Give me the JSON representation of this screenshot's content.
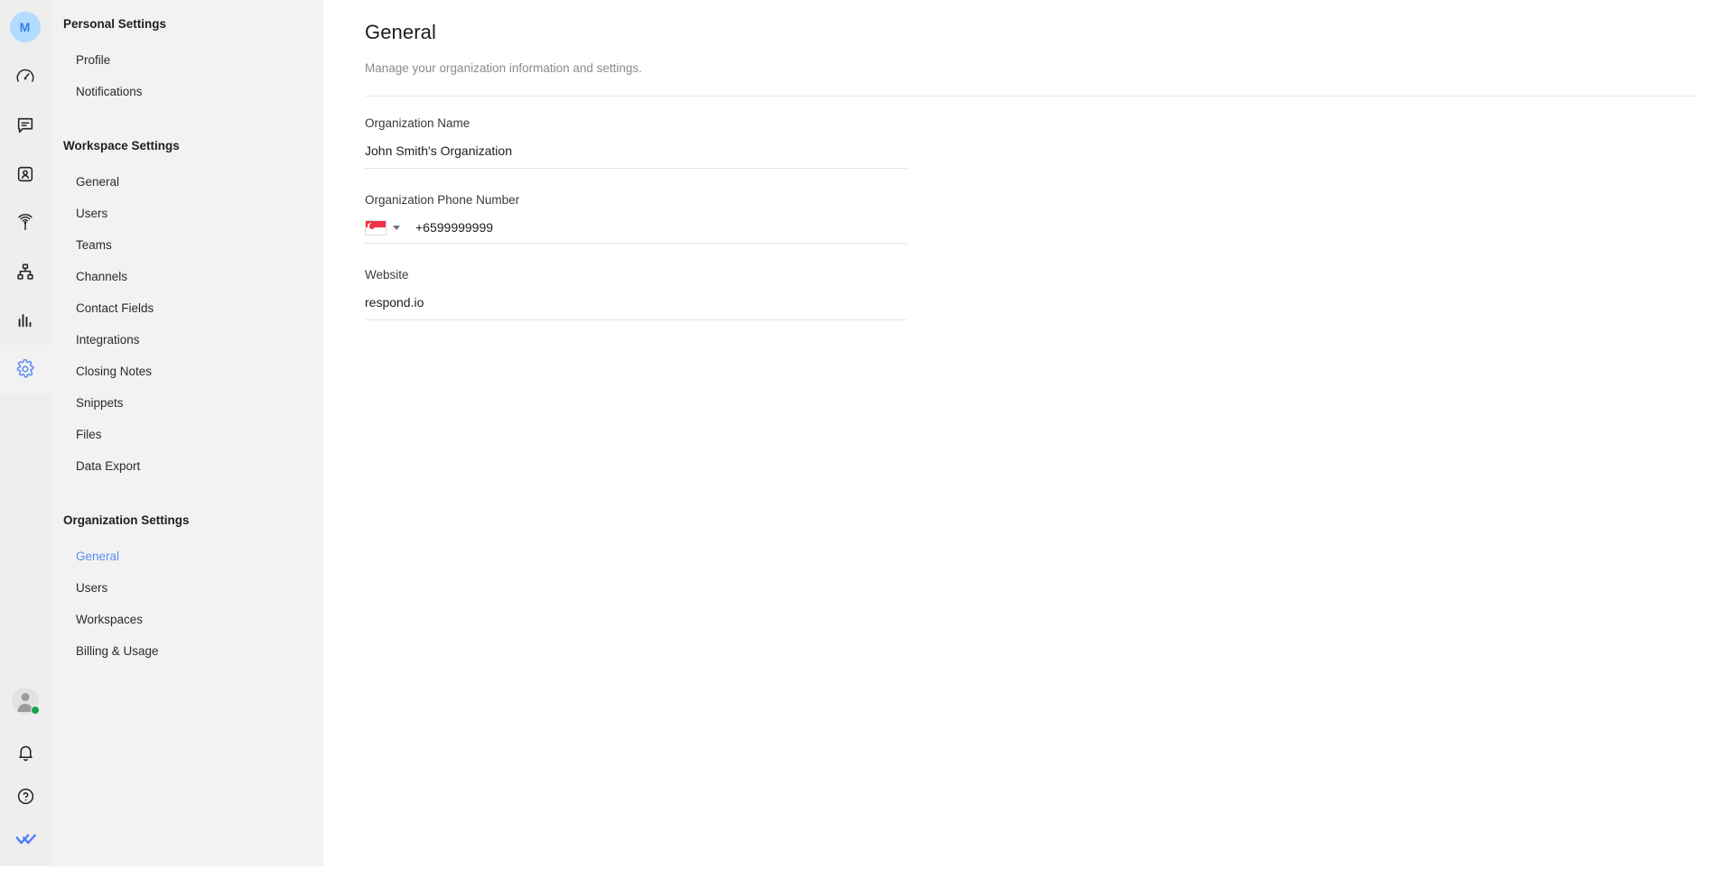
{
  "rail": {
    "org_avatar_initial": "M",
    "icons": [
      {
        "name": "dashboard-icon",
        "label": "Dashboard",
        "active": false
      },
      {
        "name": "messages-icon",
        "label": "Messages",
        "active": false
      },
      {
        "name": "contacts-icon",
        "label": "Contacts",
        "active": false
      },
      {
        "name": "broadcasts-icon",
        "label": "Broadcasts",
        "active": false
      },
      {
        "name": "workflows-icon",
        "label": "Workflows",
        "active": false
      },
      {
        "name": "reports-icon",
        "label": "Reports",
        "active": false
      },
      {
        "name": "settings-gear-icon",
        "label": "Settings",
        "active": true
      }
    ],
    "bottom_icons": [
      {
        "name": "user-avatar",
        "label": "User profile",
        "status": "online"
      },
      {
        "name": "bell-icon",
        "label": "Notifications"
      },
      {
        "name": "help-circle-icon",
        "label": "Help"
      },
      {
        "name": "respond-io-logo-icon",
        "label": "respond.io"
      }
    ],
    "active_color": "#5b8def",
    "status_color": "#16a34a"
  },
  "sidebar": {
    "groups": [
      {
        "title": "Personal Settings",
        "items": [
          {
            "label": "Profile",
            "active": false
          },
          {
            "label": "Notifications",
            "active": false
          }
        ]
      },
      {
        "title": "Workspace Settings",
        "items": [
          {
            "label": "General",
            "active": false
          },
          {
            "label": "Users",
            "active": false
          },
          {
            "label": "Teams",
            "active": false
          },
          {
            "label": "Channels",
            "active": false
          },
          {
            "label": "Contact Fields",
            "active": false
          },
          {
            "label": "Integrations",
            "active": false
          },
          {
            "label": "Closing Notes",
            "active": false
          },
          {
            "label": "Snippets",
            "active": false
          },
          {
            "label": "Files",
            "active": false
          },
          {
            "label": "Data Export",
            "active": false
          }
        ]
      },
      {
        "title": "Organization Settings",
        "items": [
          {
            "label": "General",
            "active": true
          },
          {
            "label": "Users",
            "active": false
          },
          {
            "label": "Workspaces",
            "active": false
          },
          {
            "label": "Billing & Usage",
            "active": false
          }
        ]
      }
    ]
  },
  "main": {
    "title": "General",
    "subtitle": "Manage your organization information and settings.",
    "fields": {
      "organization_name": {
        "label": "Organization Name",
        "value": "John Smith's Organization",
        "placeholder": "Organization Name"
      },
      "organization_phone": {
        "label": "Organization Phone Number",
        "value": "+6599999999",
        "placeholder": "Phone Number",
        "country_flag": "singapore-flag-icon"
      },
      "website": {
        "label": "Website",
        "value": "respond.io",
        "placeholder": "Website"
      }
    }
  }
}
